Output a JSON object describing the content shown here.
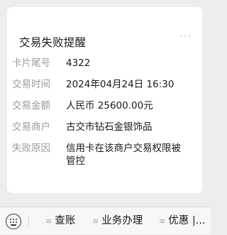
{
  "card": {
    "title": "交易失败提醒",
    "more_icon": "···",
    "rows": [
      {
        "label": "卡片尾号",
        "value": "4322"
      },
      {
        "label": "交易时间",
        "value": "2024年04月24日 16:30"
      },
      {
        "label": "交易金额",
        "value": "人民币 25600.00元"
      },
      {
        "label": "交易商户",
        "value": "古交市钻石金银饰品"
      },
      {
        "label": "失败原因",
        "value": "信用卡在该商户交易权限被管控"
      }
    ]
  },
  "bottom_menu": {
    "keyboard_icon": "keyboard-icon",
    "items": [
      {
        "icon": "≡",
        "label": "查账"
      },
      {
        "icon": "≡",
        "label": "业务办理"
      },
      {
        "icon": "≡",
        "label": "优惠 |..."
      }
    ]
  }
}
